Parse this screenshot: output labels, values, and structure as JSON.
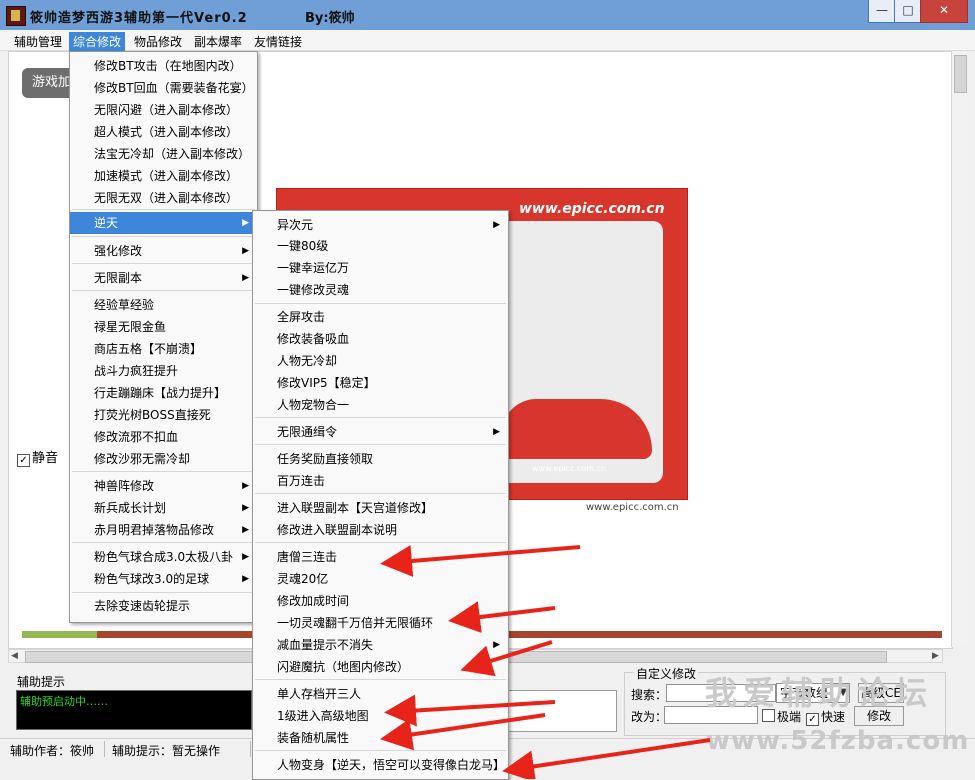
{
  "window": {
    "title": "筱帅造梦西游3辅助第一代Ver0.2",
    "author": "By:筱帅",
    "min": "—",
    "max": "□",
    "close": "✕"
  },
  "menubar": [
    "辅助管理",
    "综合修改",
    "物品修改",
    "副本爆率",
    "友情链接"
  ],
  "game_button": "游戏加",
  "ad": {
    "url": "www.epicc.com.cn",
    "car_text": "www.epicc.com.cn",
    "footer": "www.epicc.com.cn"
  },
  "mute": {
    "label": "静音",
    "check": "✓"
  },
  "progress": {
    "fill_fraction": 0.082
  },
  "bottom": {
    "hint_title": "辅助提示",
    "log_text": "辅助预启动中……",
    "custom_title": "自定义修改",
    "search_label": "搜索：",
    "change_label": "改为：",
    "type_select": "字节数组",
    "high_ce": "高级CE",
    "extreme": "极端",
    "fast": "快速",
    "fast_check": "✓",
    "modify": "修改"
  },
  "status": {
    "author": "辅助作者：筱帅",
    "hint": "辅助提示：暂无操作"
  },
  "menu1": {
    "items": [
      "修改BT攻击（在地图内改）",
      "修改BT回血（需要装备花宴）",
      "无限闪避（进入副本修改）",
      "超人模式（进入副本修改）",
      "法宝无冷却（进入副本修改）",
      "加速模式（进入副本修改）",
      "无限无双（进入副本修改）",
      "逆天",
      "强化修改",
      "无限副本",
      "经验草经验",
      "禄星无限金鱼",
      "商店五格【不崩溃】",
      "战斗力疯狂提升",
      "行走蹦蹦床【战力提升】",
      "打荧光树BOSS直接死",
      "修改流邪不扣血",
      "修改沙邪无需冷却",
      "神兽阵修改",
      "新兵成长计划",
      "赤月明君掉落物品修改",
      "粉色气球合成3.0太极八卦",
      "粉色气球改3.0的足球",
      "去除变速齿轮提示"
    ]
  },
  "menu2": {
    "items": [
      "异次元",
      "一键80级",
      "一键幸运亿万",
      "一键修改灵魂",
      "全屏攻击",
      "修改装备吸血",
      "人物无冷却",
      "修改VIP5【稳定】",
      "人物宠物合一",
      "无限通缉令",
      "任务奖励直接领取",
      "百万连击",
      "进入联盟副本【天宫道修改】",
      "修改进入联盟副本说明",
      "唐僧三连击",
      "灵魂20亿",
      "修改加成时间",
      "一切灵魂翻千万倍并无限循环",
      "减血量提示不消失",
      "闪避魔抗（地图内修改）",
      "单人存档开三人",
      "1级进入高级地图",
      "装备随机属性",
      "人物变身【逆天，悟空可以变得像白龙马】"
    ]
  },
  "submenu_glyph": "▶",
  "scroll": {
    "left": "◀",
    "right": "▶"
  },
  "watermark": {
    "line1": "我爱辅助论坛",
    "line2": "www.52fzba.com"
  },
  "colors": {
    "highlight": "#3d86d9",
    "arrow": "#e8231a",
    "titlebar": "#6f9fd6"
  }
}
